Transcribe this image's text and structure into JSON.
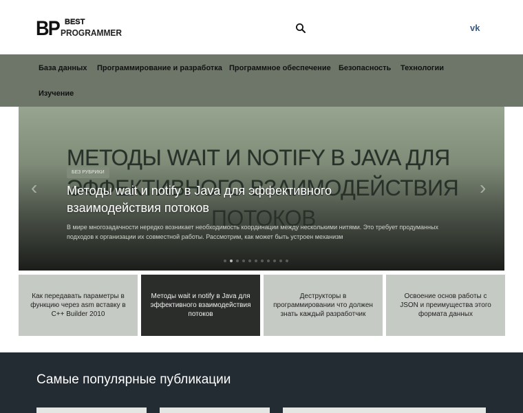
{
  "header": {
    "logo_bp": "BP",
    "logo_best": "BEST",
    "logo_programmer": "PROGRAMMER",
    "search_icon": "search-icon",
    "vk_label": "vk"
  },
  "nav": {
    "items": [
      {
        "label": "База данных"
      },
      {
        "label": "Программирование и разработка"
      },
      {
        "label": "Программное обеспечение"
      },
      {
        "label": "Безопасность"
      },
      {
        "label": "Технологии"
      },
      {
        "label": "Изучение"
      }
    ]
  },
  "slider": {
    "bg_title_line1": "МЕТОДЫ WAIT И NOTIFY В JAVA ДЛЯ",
    "bg_title_line2": "ЭФФЕКТИВНОГО ВЗАИМОДЕЙСТВИЯ",
    "bg_title_line3": "ПОТОКОВ",
    "badge": "Без рубрики",
    "title": "Методы wait и notify в Java для эффективного взаимодействия потоков",
    "excerpt": "В мире многозадачности нередко возникает необходимость координации между несколькими нитями. Это требует продуманных подходов к организации их совместной работы. Рассмотрим, как может быть устроен механизм",
    "prev_arrow": "‹",
    "next_arrow": "›",
    "dot_count": 11,
    "active_dot": 1
  },
  "thumbs": [
    {
      "text": "Как передавать параметры в функцию через asm вставку в C++ Builder 2010"
    },
    {
      "text": "Методы wait и notify в Java для эффективного взаимодействия потоков"
    },
    {
      "text": "Деструкторы в программировании что должен знать каждый разработчик"
    },
    {
      "text": "Освоение основ работы с JSON и преимущества этого формата данных"
    }
  ],
  "popular": {
    "title": "Самые популярные публикации"
  },
  "colors": {
    "nav_bg": "#6d7668",
    "popular_bg": "#232b33",
    "thumb_light": "#c6cac4",
    "thumb_dark": "#2a2d2a"
  }
}
